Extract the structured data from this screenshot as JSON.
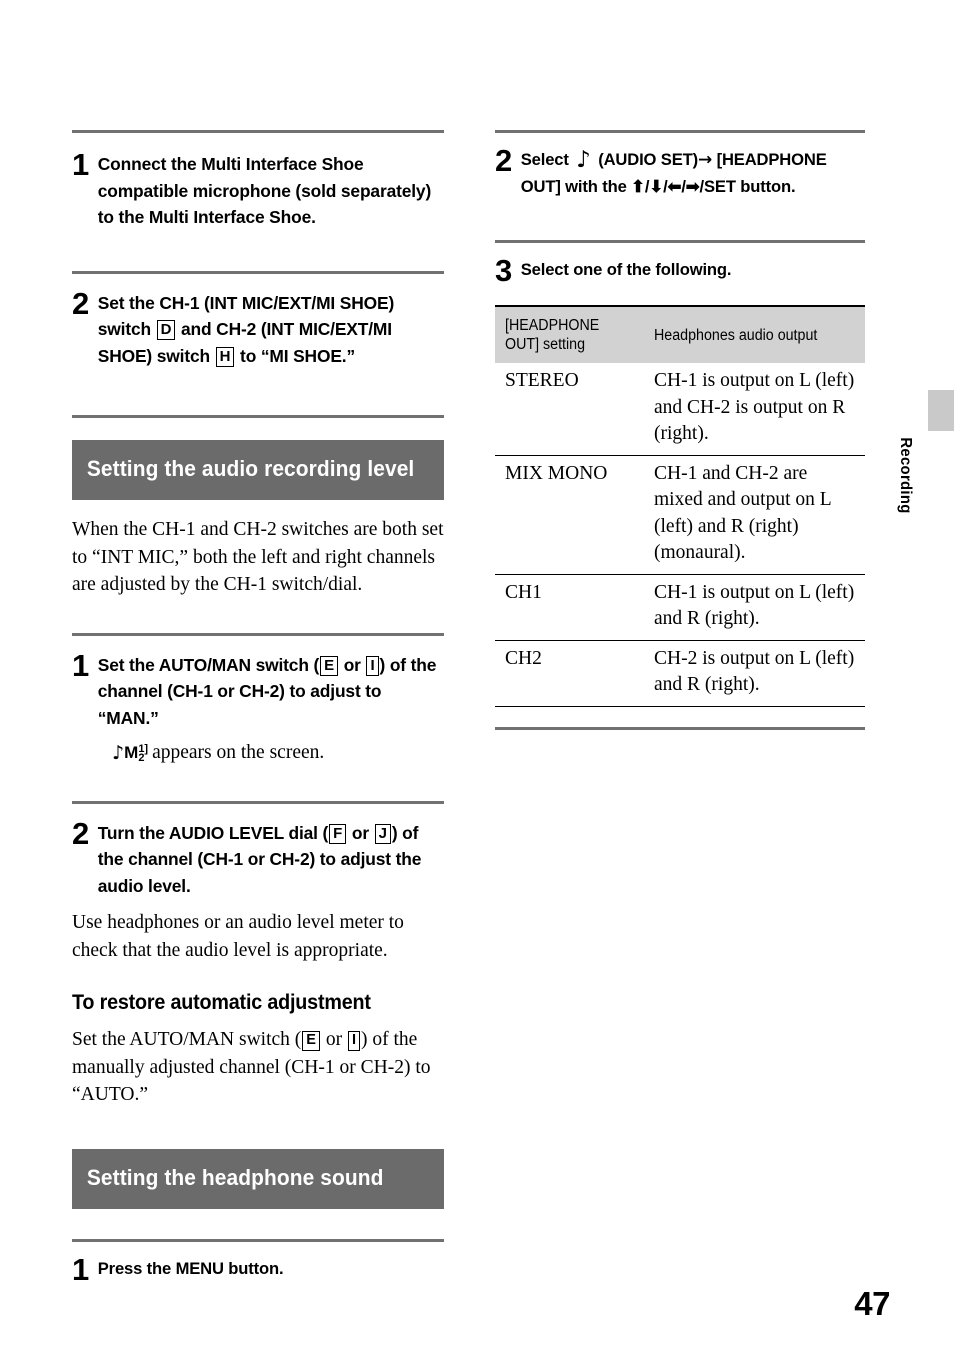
{
  "page": {
    "number": "47",
    "edge_tab_label": "Recording"
  },
  "left_column": {
    "steps_top": [
      {
        "number": "1",
        "text": "Connect the Multi Interface Shoe compatible microphone (sold separately) to the Multi Interface Shoe."
      }
    ],
    "step2": {
      "number": "2",
      "part1": "Set the CH-1 (INT MIC/EXT/MI SHOE) switch",
      "marker1": "D",
      "part2": "and CH-2 (INT MIC/EXT/MI SHOE) switch",
      "marker2": "H",
      "part3": "to “MI SHOE.”"
    },
    "section_heading_1": "Setting the audio recording level",
    "intro_paragraph": "When the CH-1 and CH-2 switches are both set to “INT MIC,” both the left and right channels are adjusted by the CH-1 switch/dial.",
    "step_level_1": {
      "number": "1",
      "part1": "Set the AUTO/MAN switch (",
      "marker1": "E",
      "part2": "or",
      "marker2": "I",
      "part3": ") of the channel (CH-1 or CH-2) to adjust to “MAN.”",
      "indicator_note": "♪",
      "indicator_letter": "M",
      "indicator_sup": "1]",
      "indicator_sub": "2",
      "indicator_caption": "appears on the screen."
    },
    "step_level_2": {
      "number": "2",
      "part1": "Turn the AUDIO LEVEL dial (",
      "marker1": "F",
      "part2": "or",
      "marker2": "J",
      "part3": ") of the channel (CH-1 or CH-2) to adjust the audio level.",
      "paragraph": "Use headphones or an audio level meter to check that the audio level is appropriate."
    },
    "restore_heading": "To restore automatic adjustment",
    "restore_paragraph_1": "Set the AUTO/MAN switch (",
    "restore_marker_1": "E",
    "restore_paragraph_2": "or",
    "restore_marker_2": "I",
    "restore_paragraph_3": ") of the manually adjusted channel (CH-1 or CH-2) to “AUTO.”",
    "section_heading_2": "Setting the headphone sound",
    "step_hp_1": {
      "number": "1",
      "text": "Press the MENU button."
    }
  },
  "right_column": {
    "step2": {
      "number": "2",
      "part1": "Select",
      "note_icon": "♪",
      "part2": "(AUDIO SET)",
      "arrow": "→",
      "part3": "[HEADPHONE OUT] with the",
      "arrows_updown": "⬆/⬇/",
      "arrows_leftright": "⬅/➡/",
      "part4": "SET button."
    },
    "step3": {
      "number": "3",
      "text": "Select one of the following."
    },
    "table": {
      "headers": [
        "[HEADPHONE OUT] setting",
        "Headphones audio output"
      ],
      "header_col1_line1": "[HEADPHONE",
      "header_col1_line2": "OUT] setting",
      "rows": [
        {
          "setting": "STEREO",
          "output": "CH-1 is output on L (left) and CH-2 is output on R (right)."
        },
        {
          "setting": "MIX MONO",
          "output": "CH-1 and CH-2 are mixed and output on L (left) and R (right) (monaural)."
        },
        {
          "setting": "CH1",
          "output": "CH-1 is output on L (left) and R (right)."
        },
        {
          "setting": "CH2",
          "output": "CH-2 is output on L (left) and R (right)."
        }
      ]
    }
  },
  "colors": {
    "bar_gray": "#6b6b6b",
    "rule_gray": "#717171",
    "table_header_gray": "#d2d2d2",
    "tab_gray": "#c9c9c9"
  }
}
